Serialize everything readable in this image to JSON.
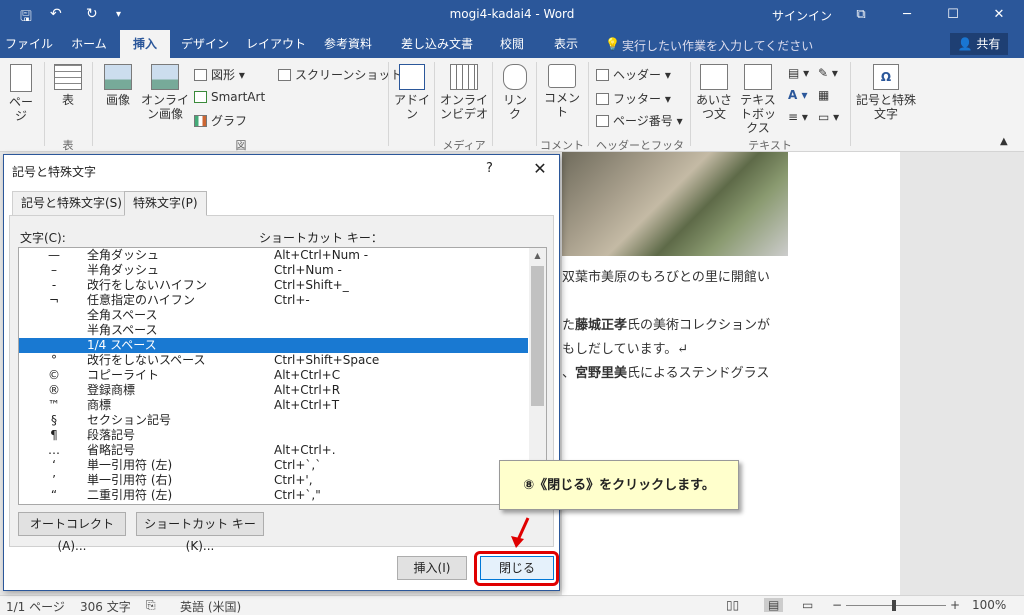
{
  "titlebar": {
    "title": "mogi4-kadai4 - Word",
    "signin": "サインイン",
    "restore_glyph": "⧉",
    "minimize_glyph": "─",
    "maximize_glyph": "☐",
    "close_glyph": "✕"
  },
  "tabs": [
    "ファイル",
    "ホーム",
    "挿入",
    "デザイン",
    "レイアウト",
    "参考資料",
    "差し込み文書",
    "校閲",
    "表示"
  ],
  "tell_me": "実行したい作業を入力してください",
  "share": "共有",
  "ribbon": {
    "page": "ページ",
    "table": "表",
    "image": "画像",
    "online_image": "オンライン画像",
    "shapes": "図形",
    "smartart": "SmartArt",
    "graph": "グラフ",
    "screenshot": "スクリーンショット",
    "addin": "アドイン",
    "online_video": "オンラインビデオ",
    "link": "リンク",
    "comment": "コメント",
    "header": "ヘッダー",
    "footer": "フッター",
    "page_number": "ページ番号",
    "greeting": "あいさつ文",
    "textbox": "テキストボックス",
    "symbol": "記号と特殊文字",
    "groups": {
      "table": "表",
      "figure": "図",
      "media": "メディア",
      "comment": "コメント",
      "header_footer": "ヘッダーとフッター",
      "text": "テキスト"
    }
  },
  "document": {
    "line1": "双葉市美原のもろびとの里に開館い",
    "line2_pre": "た",
    "line2_bold": "藤城正孝",
    "line2_post": "氏の美術コレクションが",
    "line3": "もしだしています。↵",
    "line4_pre": "、",
    "line4_bold": "宮野里美",
    "line4_post": "氏によるステンドグラス"
  },
  "dialog": {
    "title": "記号と特殊文字",
    "help": "?",
    "close_x": "✕",
    "tab1": "記号と特殊文字(S)",
    "tab2": "特殊文字(P)",
    "col_char": "文字(C):",
    "col_shortcut": "ショートカット キー：",
    "rows": [
      {
        "c": "—",
        "n": "全角ダッシュ",
        "k": "Alt+Ctrl+Num -"
      },
      {
        "c": "–",
        "n": "半角ダッシュ",
        "k": "Ctrl+Num -"
      },
      {
        "c": "-",
        "n": "改行をしないハイフン",
        "k": "Ctrl+Shift+_"
      },
      {
        "c": "¬",
        "n": "任意指定のハイフン",
        "k": "Ctrl+-"
      },
      {
        "c": "",
        "n": "全角スペース",
        "k": ""
      },
      {
        "c": "",
        "n": "半角スペース",
        "k": ""
      },
      {
        "c": "",
        "n": "1/4 スペース",
        "k": ""
      },
      {
        "c": "°",
        "n": "改行をしないスペース",
        "k": "Ctrl+Shift+Space"
      },
      {
        "c": "©",
        "n": "コピーライト",
        "k": "Alt+Ctrl+C"
      },
      {
        "c": "®",
        "n": "登録商標",
        "k": "Alt+Ctrl+R"
      },
      {
        "c": "™",
        "n": "商標",
        "k": "Alt+Ctrl+T"
      },
      {
        "c": "§",
        "n": "セクション記号",
        "k": ""
      },
      {
        "c": "¶",
        "n": "段落記号",
        "k": ""
      },
      {
        "c": "…",
        "n": "省略記号",
        "k": "Alt+Ctrl+."
      },
      {
        "c": "‘",
        "n": "単一引用符 (左)",
        "k": "Ctrl+`,`"
      },
      {
        "c": "’",
        "n": "単一引用符 (右)",
        "k": "Ctrl+',"
      },
      {
        "c": "“",
        "n": "二重引用符 (左)",
        "k": "Ctrl+`,\""
      }
    ],
    "selected_index": 6,
    "autocorrect": "オートコレクト(A)...",
    "shortcut": "ショートカット キー(K)...",
    "insert": "挿入(I)",
    "close": "閉じる"
  },
  "callout": "⑧《閉じる》をクリックします。",
  "statusbar": {
    "page": "1/1 ページ",
    "words": "306 文字",
    "lang": "英語 (米国)",
    "zoom": "100%"
  },
  "colors": {
    "word_blue": "#2b579a",
    "selection": "#1979d2",
    "highlight_red": "#e00000"
  }
}
